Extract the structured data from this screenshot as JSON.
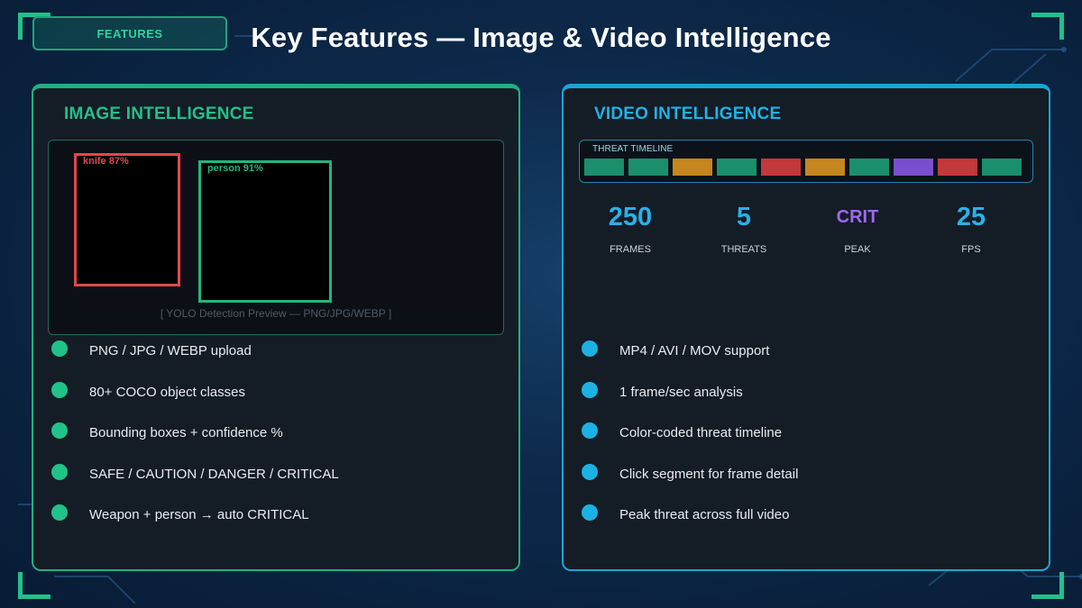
{
  "header": {
    "badge": "FEATURES",
    "title": "Key Features — Image & Video Intelligence"
  },
  "image_panel": {
    "title": "IMAGE INTELLIGENCE",
    "preview": {
      "detections": [
        {
          "label": "knife 87%",
          "color": "#e04848"
        },
        {
          "label": "person 91%",
          "color": "#22b57d"
        }
      ],
      "caption": "[ YOLO Detection Preview — PNG/JPG/WEBP ]"
    },
    "bullets": [
      "PNG / JPG / WEBP upload",
      "80+ COCO object classes",
      "Bounding boxes + confidence %",
      "SAFE / CAUTION / DANGER / CRITICAL",
      "Weapon + person → auto CRITICAL"
    ]
  },
  "video_panel": {
    "title": "VIDEO INTELLIGENCE",
    "timeline": {
      "label": "THREAT TIMELINE",
      "segments": [
        "#1a8f6c",
        "#1a8f6c",
        "#c7851d",
        "#1a8f6c",
        "#c4373a",
        "#c7851d",
        "#1a8f6c",
        "#7a4fcf",
        "#c4373a",
        "#1a8f6c"
      ]
    },
    "stats": [
      {
        "value": "250",
        "label": "FRAMES"
      },
      {
        "value": "5",
        "label": "THREATS"
      },
      {
        "value": "CRIT",
        "label": "PEAK"
      },
      {
        "value": "25",
        "label": "FPS"
      }
    ],
    "bullets": [
      "MP4 / AVI / MOV support",
      "1 frame/sec analysis",
      "Color-coded threat timeline",
      "Click segment for frame detail",
      "Peak threat across full video"
    ]
  },
  "colors": {
    "accent_green": "#22c08a",
    "accent_blue": "#1eb3e6",
    "crit_purple": "#9e69f2"
  }
}
